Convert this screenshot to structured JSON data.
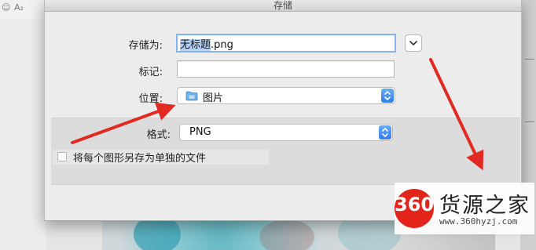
{
  "background_app": {
    "toolbar_glyphs": [
      "☺",
      "A₂"
    ]
  },
  "dialog": {
    "title": "存储",
    "save_as_label": "存储为:",
    "filename_selected": "无标题",
    "filename_ext": ".png",
    "tags_label": "标记:",
    "tags_value": "",
    "location_label": "位置:",
    "location_value": "图片",
    "format_label": "格式:",
    "format_value": "PNG",
    "checkbox_label": "将每个图形另存为单独的文件",
    "checkbox_checked": false
  },
  "watermark": {
    "logo_number": "360",
    "brand": "货源之家",
    "url": "www.360hyzj.com"
  },
  "colors": {
    "accent_blue": "#2f7df0",
    "arrow_red": "#e02a22",
    "logo_red": "#e2241b"
  },
  "icons": [
    "folder-icon",
    "chevron-down-icon",
    "up-down-stepper-icon"
  ]
}
